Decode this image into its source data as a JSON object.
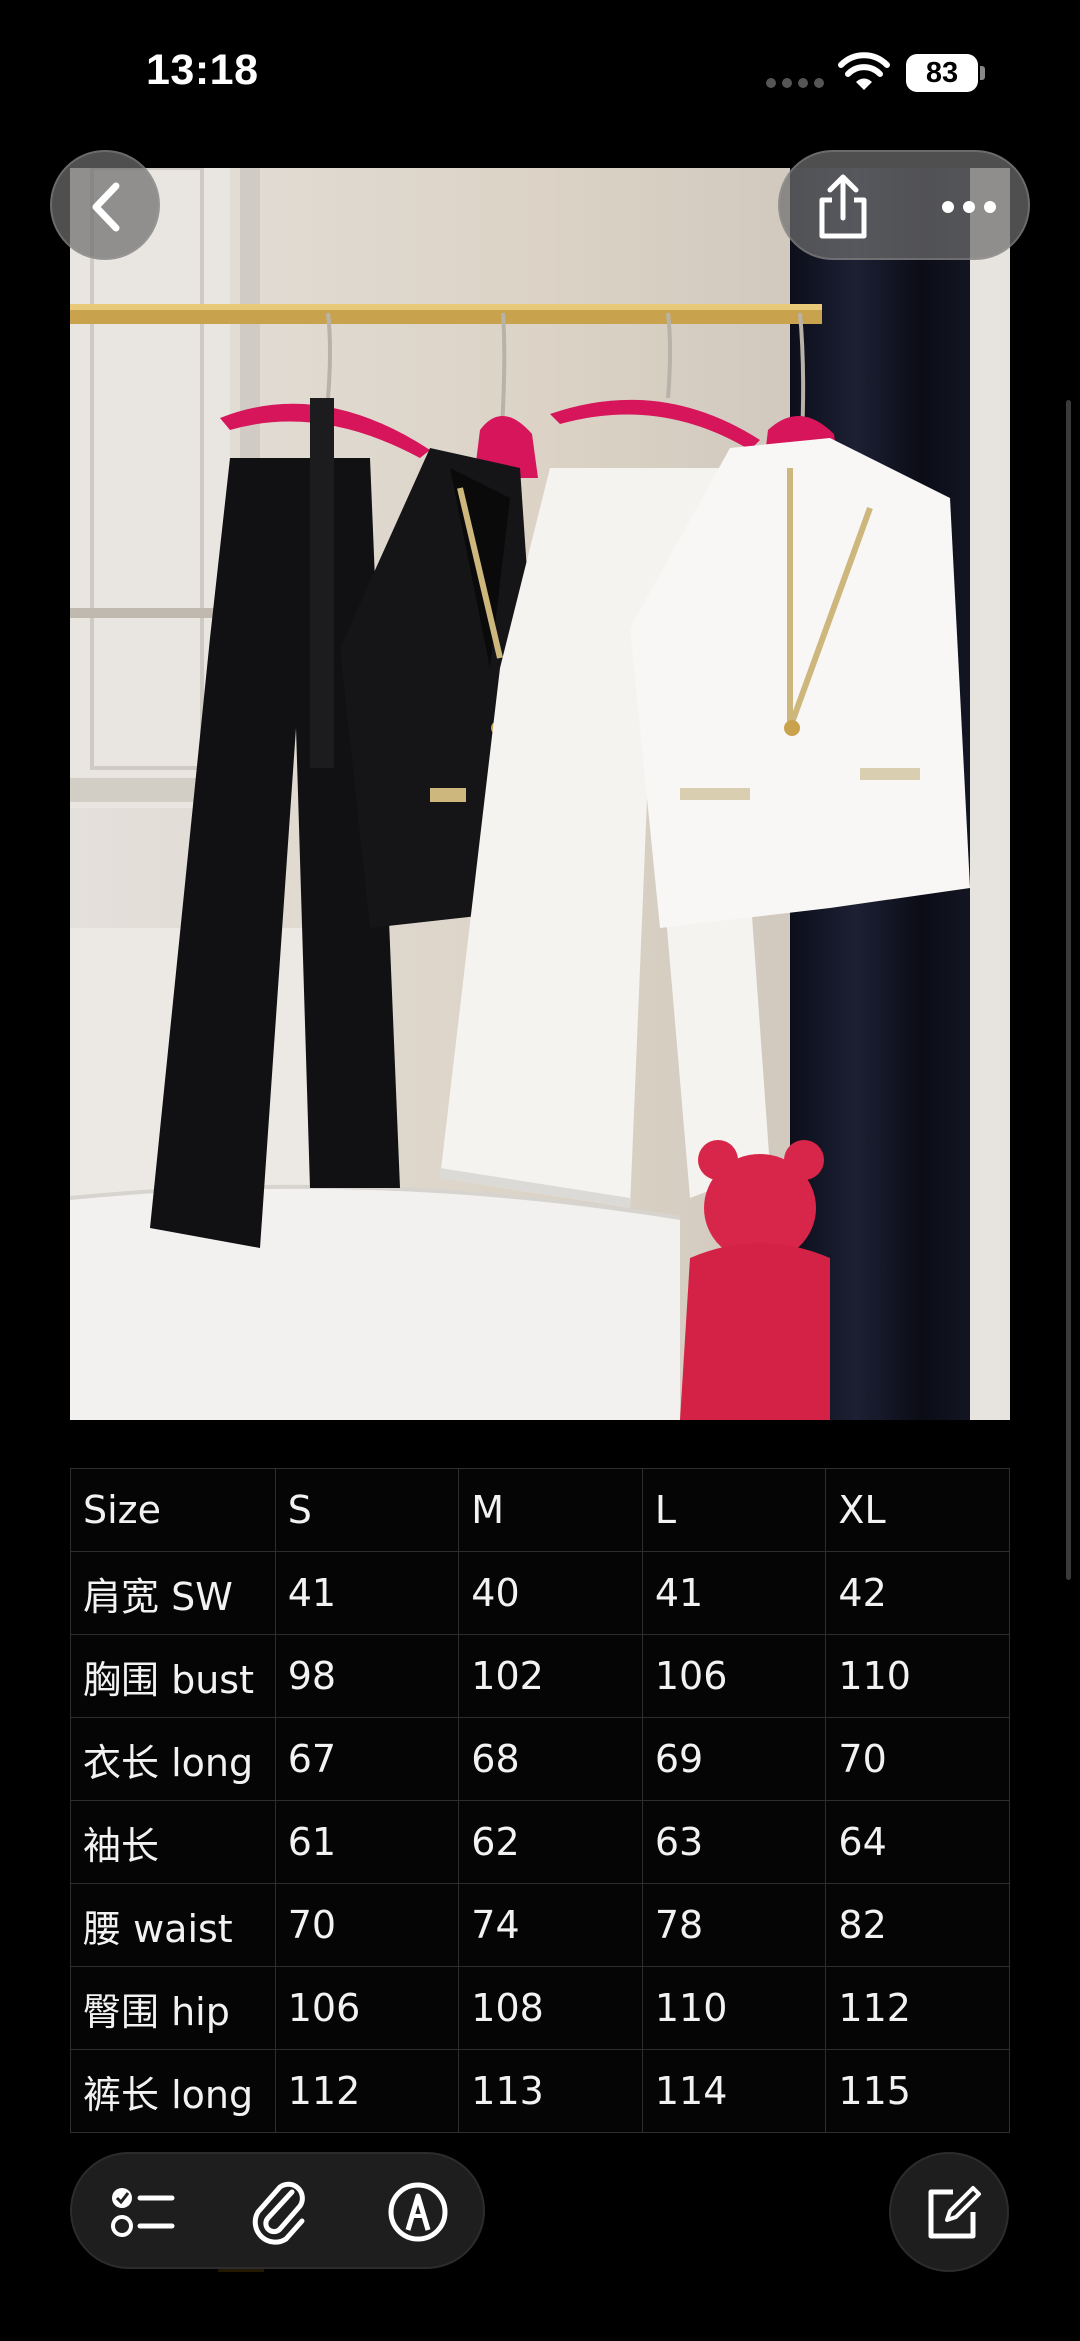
{
  "status_bar": {
    "time": "13:18",
    "battery": "83"
  },
  "image": {
    "description": "black and white suits on hangers"
  },
  "size_table": {
    "header": [
      "Size",
      "S",
      "M",
      "L",
      "XL"
    ],
    "rows": [
      [
        "肩宽 SW",
        "41",
        "40",
        "41",
        "42"
      ],
      [
        "胸围 bust",
        "98",
        "102",
        "106",
        "110"
      ],
      [
        "衣长 long",
        "67",
        "68",
        "69",
        "70"
      ],
      [
        "袖长",
        "61",
        "62",
        "63",
        "64"
      ],
      [
        "腰 waist",
        "70",
        "74",
        "78",
        "82"
      ],
      [
        "臀围 hip",
        "106",
        "108",
        "110",
        "112"
      ],
      [
        "裤长 long",
        "112",
        "113",
        "114",
        "115"
      ]
    ]
  },
  "icons": {
    "back": "chevron-left-icon",
    "share": "share-icon",
    "more": "more-horizontal-icon",
    "checklist": "checklist-icon",
    "attach": "paperclip-icon",
    "markup": "pen-circle-icon",
    "compose": "compose-icon"
  },
  "colors": {
    "background": "#000000",
    "hanger": "#d6155a",
    "table_border": "#2e2e2e"
  }
}
